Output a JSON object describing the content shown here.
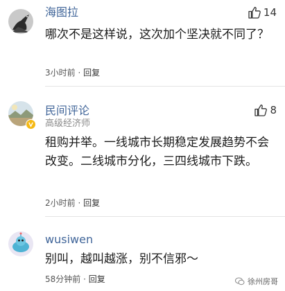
{
  "comments": [
    {
      "username": "海图拉",
      "likes": "14",
      "content": "哪次不是这样说，这次加个坚决就不同了？",
      "time": "3小时前",
      "separator": "·",
      "reply": "回复",
      "avatar_icon": "crow-avatar-icon"
    },
    {
      "username": "民间评论",
      "subtitle": "高级经济师",
      "likes": "8",
      "content": "租购并举。一线城市长期稳定发展趋势不会改变。二线城市分化，三四线城市下跌。",
      "time": "2小时前",
      "separator": "·",
      "reply": "回复",
      "avatar_icon": "landscape-avatar-icon"
    },
    {
      "username": "wusiwen",
      "content": "别叫，越叫越涨，别不信邪～",
      "time": "58分钟前",
      "separator": "·",
      "reply": "回复",
      "avatar_icon": "robot-avatar-icon"
    }
  ],
  "watermark": {
    "text": "徐州房哥"
  },
  "colors": {
    "username": "#406599",
    "content": "#1a1a1a",
    "meta": "#555555"
  }
}
